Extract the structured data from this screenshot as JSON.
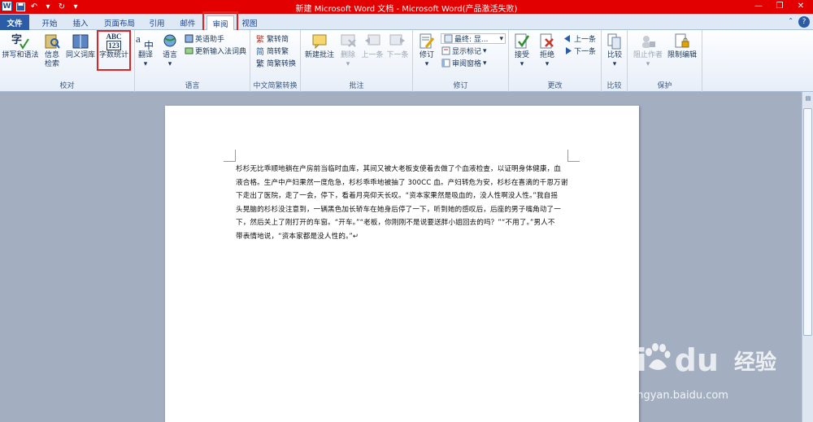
{
  "window": {
    "title": "新建 Microsoft Word 文档 - Microsoft Word(产品激活失败)",
    "qat": {
      "app_icon": "W",
      "save_icon": "save-icon",
      "undo_icon": "undo-icon",
      "redo_icon": "redo-icon"
    },
    "controls": {
      "minimize": "—",
      "restore": "❐",
      "close": "✕"
    }
  },
  "tabs": [
    {
      "label": "文件"
    },
    {
      "label": "开始"
    },
    {
      "label": "插入"
    },
    {
      "label": "页面布局"
    },
    {
      "label": "引用"
    },
    {
      "label": "邮件"
    },
    {
      "label": "审阅"
    },
    {
      "label": "视图"
    }
  ],
  "help": "?",
  "ribbon": {
    "proofing": {
      "label": "校对",
      "spelling": "拼写和语法",
      "research_1": "信息",
      "research_2": "检索",
      "thesaurus": "同义词库",
      "wordcount": "字数统计",
      "wordcount_icon_line1": "ABC",
      "wordcount_icon_line2": "123"
    },
    "language": {
      "label": "语言",
      "translate": "翻译",
      "language": "语言",
      "english_assistant": "英语助手",
      "update_ime": "更新输入法词典"
    },
    "chinese_conversion": {
      "label": "中文简繁转换",
      "to_traditional": "繁转简",
      "to_simplified": "简转繁",
      "conversion": "简繁转换"
    },
    "comments": {
      "label": "批注",
      "new": "新建批注",
      "delete": "删除",
      "previous": "上一条",
      "next": "下一条"
    },
    "tracking": {
      "label": "修订",
      "track_changes": "修订",
      "final_markup": "最终: 显...",
      "show_markup": "显示标记",
      "reviewing_pane": "审阅窗格"
    },
    "changes": {
      "label": "更改",
      "accept": "接受",
      "reject": "拒绝",
      "previous": "上一条",
      "next": "下一条"
    },
    "compare": {
      "label": "比较",
      "compare": "比较"
    },
    "protect": {
      "label": "保护",
      "block_authors": "阻止作者",
      "restrict_editing": "限制编辑"
    }
  },
  "document": {
    "lines": [
      "杉杉无比乖顺地躺在产房前当临时血库，其间又被大老板支使着去做了个血液检查，以证明身体健康，血",
      "液合格。生产中产妇果然一度危急，杉杉乖乖地被抽了 300CC 血。产妇转危为安，杉杉在喜滴的千恩万谢",
      "下走出了医院，走了一会，停下，看着月亮仰天长叹。“资本家果然是吸血的，没人性啊没人性。”我自摇",
      "头晃脑的杉杉没注意到，一辆黑色加长轿车在她身后停了一下，听到她的感叹后，后座的男子嘴角动了一",
      "下，然后关上了刚打开的车窗。“开车。”“老板，你刚刚不是说要送胖小姐回去的吗？”“不用了。”男人不",
      "带表情地说，“资本家都是没人性的。”↵"
    ]
  },
  "watermark": {
    "logo_text": "Bai",
    "logo_text_2": "du",
    "brand_cn": "经验",
    "url": "jingyan.baidu.com"
  }
}
